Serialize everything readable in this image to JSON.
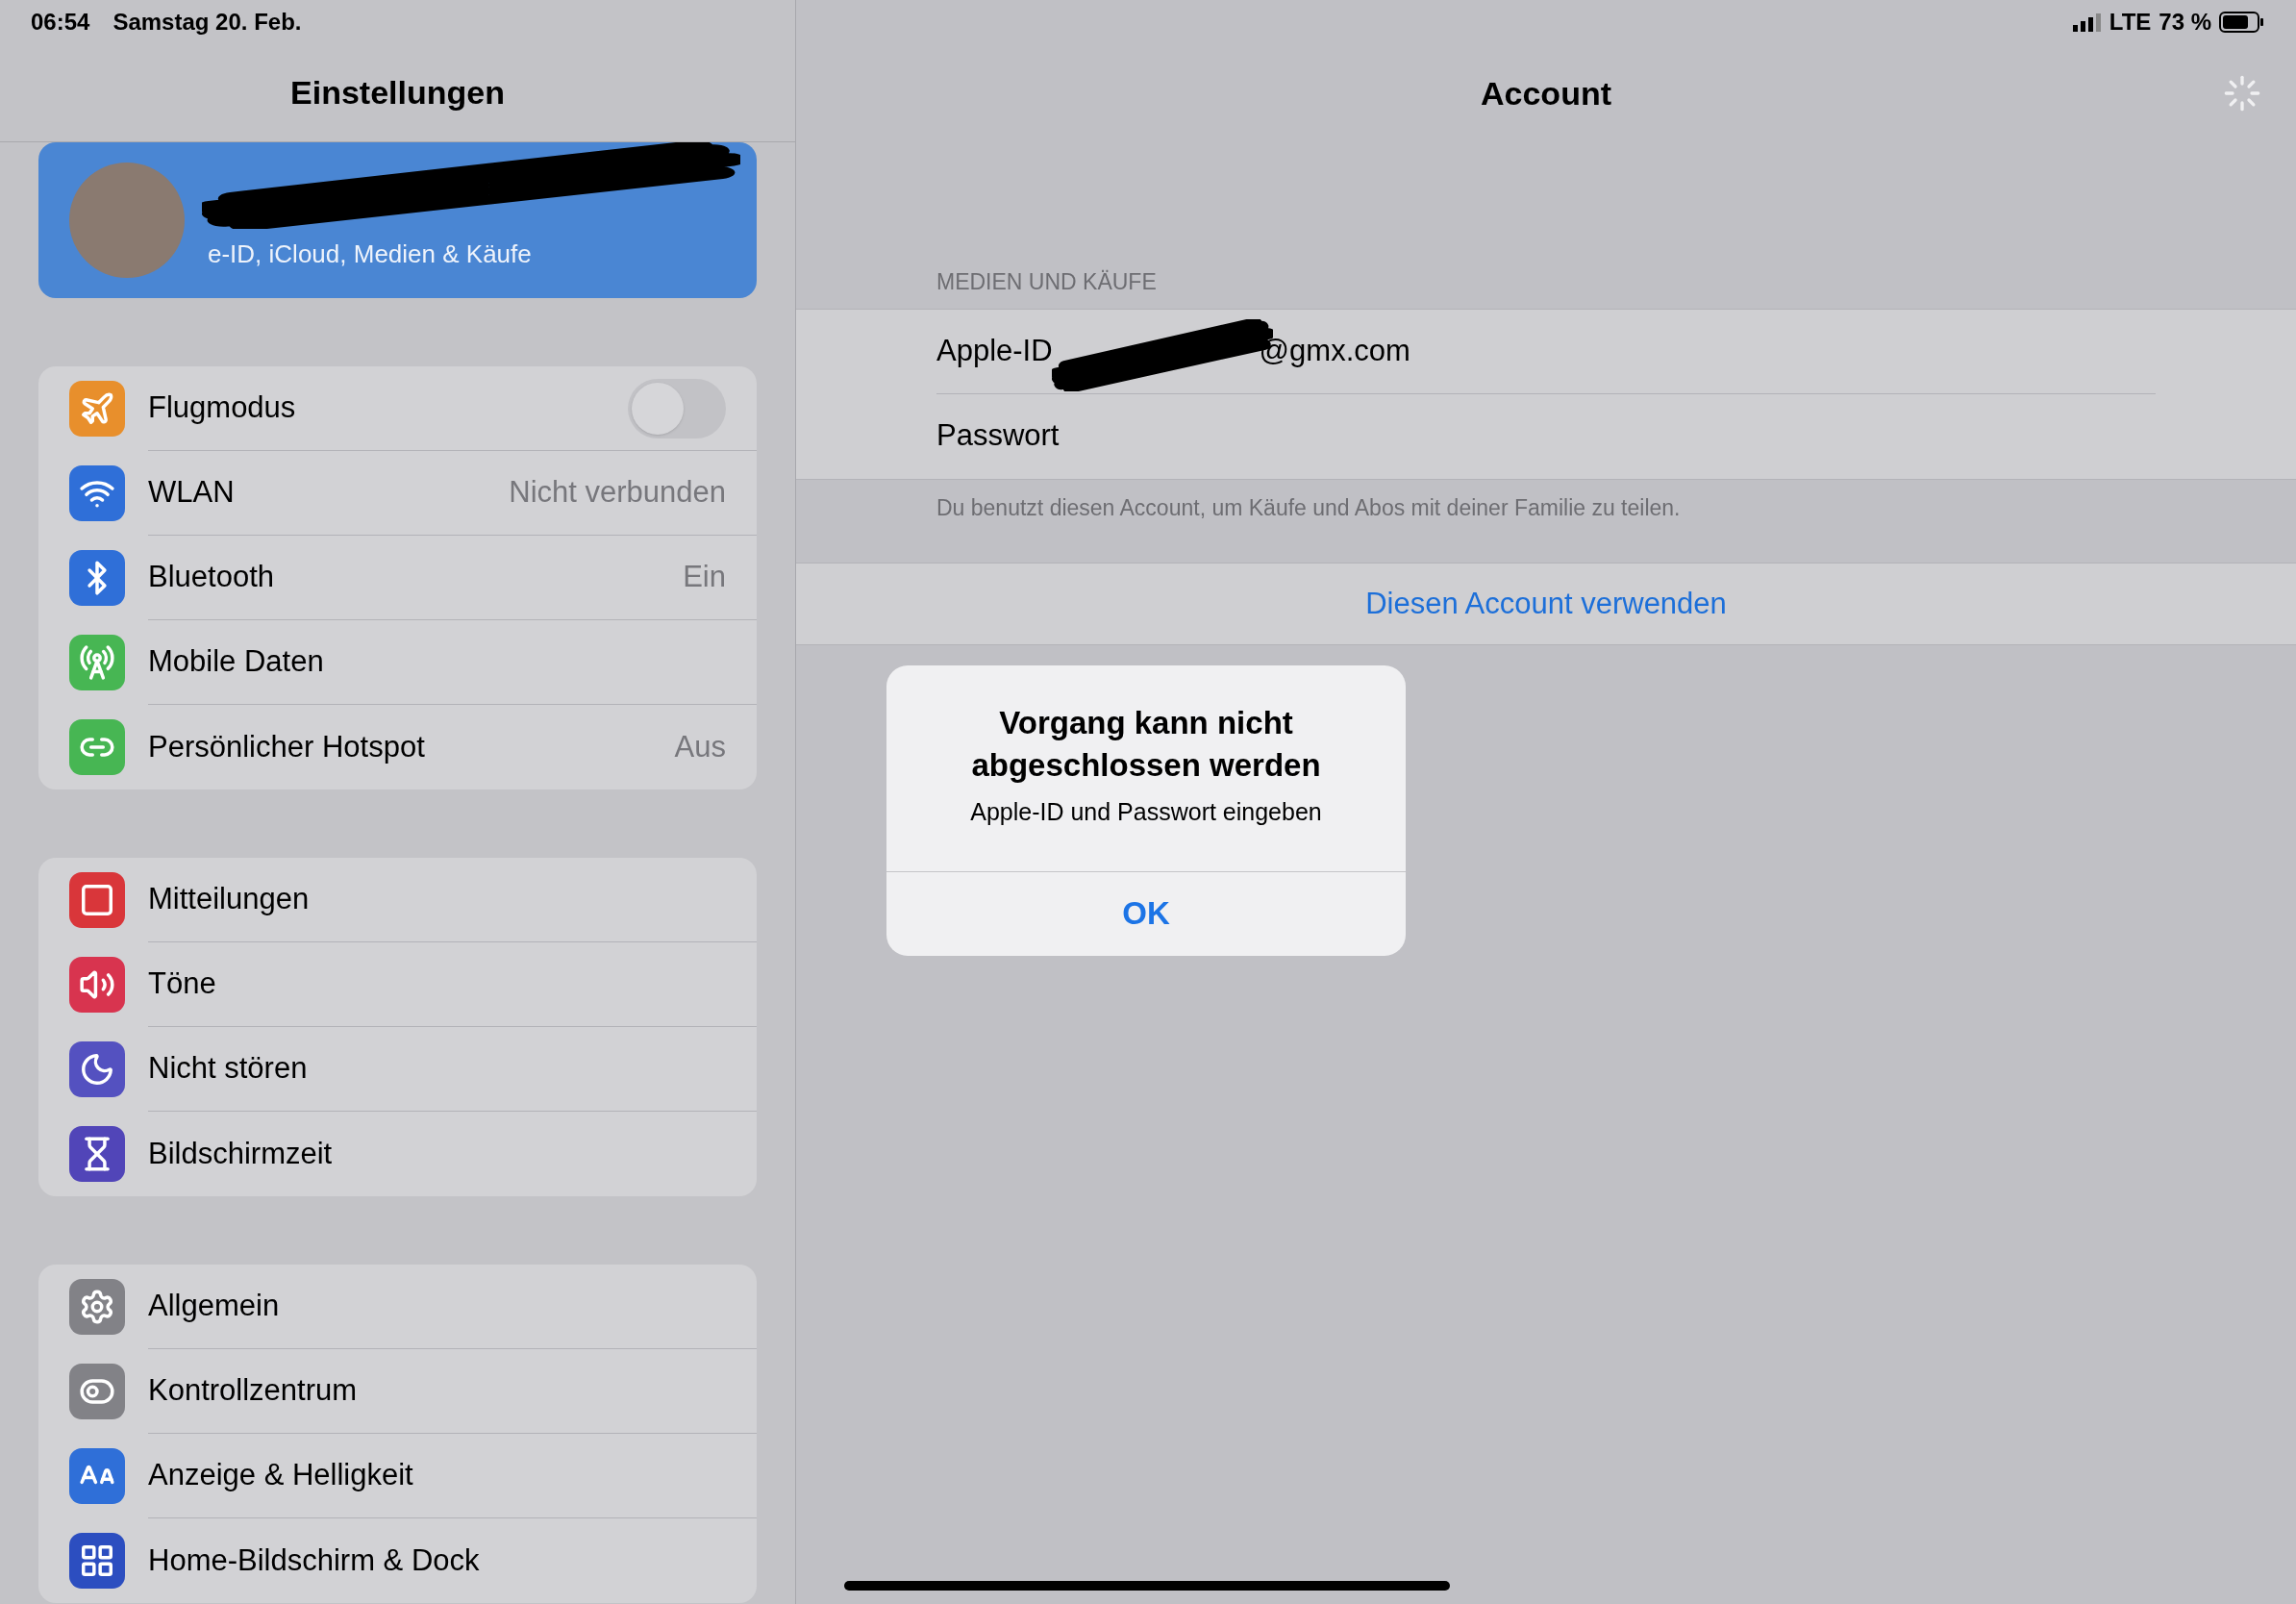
{
  "status_bar": {
    "time": "06:54",
    "date": "Samstag 20. Feb.",
    "network": "LTE",
    "battery": "73 %"
  },
  "sidebar": {
    "title": "Einstellungen",
    "profile": {
      "subtitle": "e-ID, iCloud, Medien & Käufe"
    },
    "groups": [
      [
        {
          "label": "Flugmodus",
          "kind": "toggle",
          "on": false,
          "color": "#e88f2c"
        },
        {
          "label": "WLAN",
          "kind": "value",
          "value": "Nicht verbunden",
          "color": "#2f6fd8"
        },
        {
          "label": "Bluetooth",
          "kind": "value",
          "value": "Ein",
          "color": "#2f6fd8"
        },
        {
          "label": "Mobile Daten",
          "kind": "plain",
          "color": "#47b653"
        },
        {
          "label": "Persönlicher Hotspot",
          "kind": "value",
          "value": "Aus",
          "color": "#47b653"
        }
      ],
      [
        {
          "label": "Mitteilungen",
          "kind": "plain",
          "color": "#d9363a"
        },
        {
          "label": "Töne",
          "kind": "plain",
          "color": "#d8344f"
        },
        {
          "label": "Nicht stören",
          "kind": "plain",
          "color": "#5451c0"
        },
        {
          "label": "Bildschirmzeit",
          "kind": "plain",
          "color": "#5145b8"
        }
      ],
      [
        {
          "label": "Allgemein",
          "kind": "plain",
          "color": "#828287"
        },
        {
          "label": "Kontrollzentrum",
          "kind": "plain",
          "color": "#828287"
        },
        {
          "label": "Anzeige & Helligkeit",
          "kind": "plain",
          "color": "#2f6fd8"
        },
        {
          "label": "Home-Bildschirm & Dock",
          "kind": "plain",
          "color": "#2c4ec0"
        }
      ]
    ]
  },
  "detail": {
    "title": "Account",
    "section_header": "MEDIEN UND KÄUFE",
    "rows": [
      {
        "label": "Apple-ID",
        "value": "@gmx.com"
      },
      {
        "label": "Passwort"
      }
    ],
    "footer": "Du benutzt diesen Account, um Käufe und Abos mit deiner Familie zu teilen.",
    "action": "Diesen Account verwenden"
  },
  "alert": {
    "title": "Vorgang kann nicht abgeschlossen werden",
    "message": "Apple-ID und Passwort eingeben",
    "button": "OK"
  }
}
